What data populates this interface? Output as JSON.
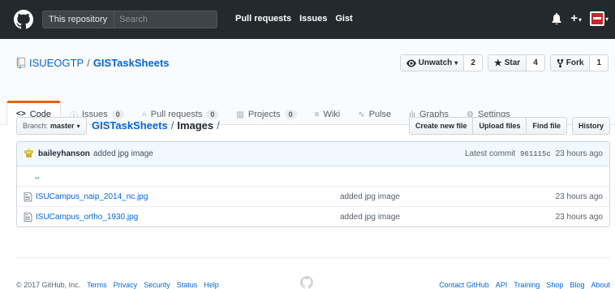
{
  "header": {
    "search_scope": "This repository",
    "search_placeholder": "Search",
    "nav": [
      "Pull requests",
      "Issues",
      "Gist"
    ]
  },
  "repo": {
    "owner": "ISUEOGTP",
    "separator": "/",
    "name": "GISTaskSheets",
    "watch_label": "Unwatch",
    "watch_count": "2",
    "star_label": "Star",
    "star_count": "4",
    "fork_label": "Fork",
    "fork_count": "1"
  },
  "tabs": [
    {
      "label": "Code",
      "icon": "<>",
      "count": null,
      "selected": true
    },
    {
      "label": "Issues",
      "icon": "ⓘ",
      "count": "0"
    },
    {
      "label": "Pull requests",
      "icon": "⑃",
      "count": "0"
    },
    {
      "label": "Projects",
      "icon": "▥",
      "count": "0"
    },
    {
      "label": "Wiki",
      "icon": "≡",
      "count": null
    },
    {
      "label": "Pulse",
      "icon": "∿",
      "count": null
    },
    {
      "label": "Graphs",
      "icon": "ılı",
      "count": null
    },
    {
      "label": "Settings",
      "icon": "⚙",
      "count": null
    }
  ],
  "filenav": {
    "branch_prefix": "Branch:",
    "branch": "master",
    "crumb_root": "GISTaskSheets",
    "crumb_sep": "/",
    "crumb_current": "Images",
    "crumb_trailing": "/",
    "buttons": [
      "Create new file",
      "Upload files",
      "Find file",
      "History"
    ]
  },
  "commit": {
    "author": "baileyhanson",
    "message": "added jpg image",
    "latest_label": "Latest commit",
    "sha": "961115c",
    "age": "23 hours ago"
  },
  "files": {
    "up": "..",
    "rows": [
      {
        "name": "ISUCampus_naip_2014_nc.jpg",
        "message": "added jpg image",
        "age": "23 hours ago"
      },
      {
        "name": "ISUCampus_ortho_1930.jpg",
        "message": "added jpg image",
        "age": "23 hours ago"
      }
    ]
  },
  "footer": {
    "copyright": "© 2017 GitHub, Inc.",
    "left_links": [
      "Terms",
      "Privacy",
      "Security",
      "Status",
      "Help"
    ],
    "right_links": [
      "Contact GitHub",
      "API",
      "Training",
      "Shop",
      "Blog",
      "About"
    ]
  },
  "colors": {
    "nav_bg": "#24292e",
    "link": "#0366d6",
    "selected_tab_accent": "#e36209",
    "commit_bg": "#f1f8ff"
  },
  "icons": {
    "logo": "github-octocat-icon",
    "notifications": "bell-icon",
    "add": "plus-icon",
    "repo": "repo-icon",
    "file": "file-icon",
    "watch": "eye-icon",
    "star": "star-icon",
    "fork": "fork-icon"
  }
}
